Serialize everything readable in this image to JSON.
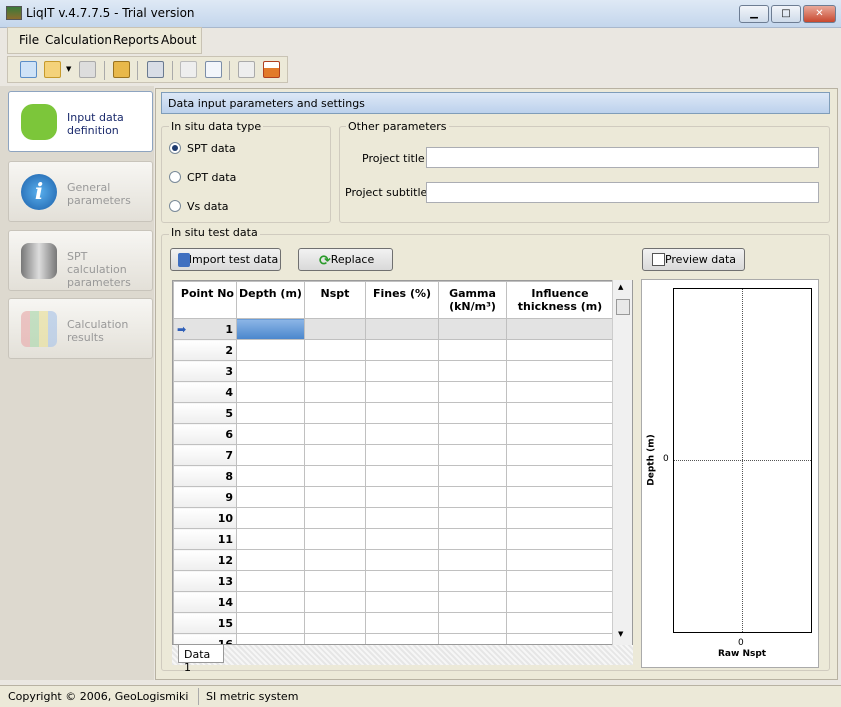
{
  "window": {
    "title": "LiqIT v.4.7.7.5 - Trial version",
    "minimize": "▁",
    "maximize": "□",
    "close": "✕"
  },
  "menu": [
    "File",
    "Calculation",
    "Reports",
    "About"
  ],
  "toolbar": [
    "new-icon",
    "open-icon",
    "save-icon",
    "edit-icon",
    "calculator-icon",
    "report-icon",
    "report-edit-icon",
    "chart-icon",
    "profile-icon"
  ],
  "nav": [
    {
      "label": "Input data definition",
      "selected": true
    },
    {
      "label": "General parameters"
    },
    {
      "label": "SPT calculation parameters"
    },
    {
      "label": "Calculation results"
    }
  ],
  "header": "Data input parameters and settings",
  "datatype": {
    "legend": "In situ data type",
    "options": [
      "SPT data",
      "CPT data",
      "Vs data"
    ],
    "selected": "SPT data"
  },
  "other": {
    "legend": "Other parameters",
    "title_label": "Project title",
    "title_value": "",
    "subtitle_label": "Project subtitle",
    "subtitle_value": ""
  },
  "test": {
    "legend": "In situ test data",
    "import": "Import test data",
    "replace": "Replace",
    "preview": "Preview data",
    "columns": [
      "Point No",
      "Depth (m)",
      "Nspt",
      "Fines (%)",
      "Gamma (kN/m³)",
      "Influence thickness (m)"
    ],
    "rows": [
      "1",
      "2",
      "3",
      "4",
      "5",
      "6",
      "7",
      "8",
      "9",
      "10",
      "11",
      "12",
      "13",
      "14",
      "15",
      "16"
    ],
    "sheet_tab": "Data 1"
  },
  "chart_data": {
    "type": "scatter",
    "xlabel": "Raw Nspt",
    "ylabel": "Depth (m)",
    "xticks": [
      "0"
    ],
    "yticks": [
      "0"
    ],
    "series": []
  },
  "status": {
    "copyright": "Copyright © 2006, GeoLogismiki",
    "units": "SI metric system"
  }
}
